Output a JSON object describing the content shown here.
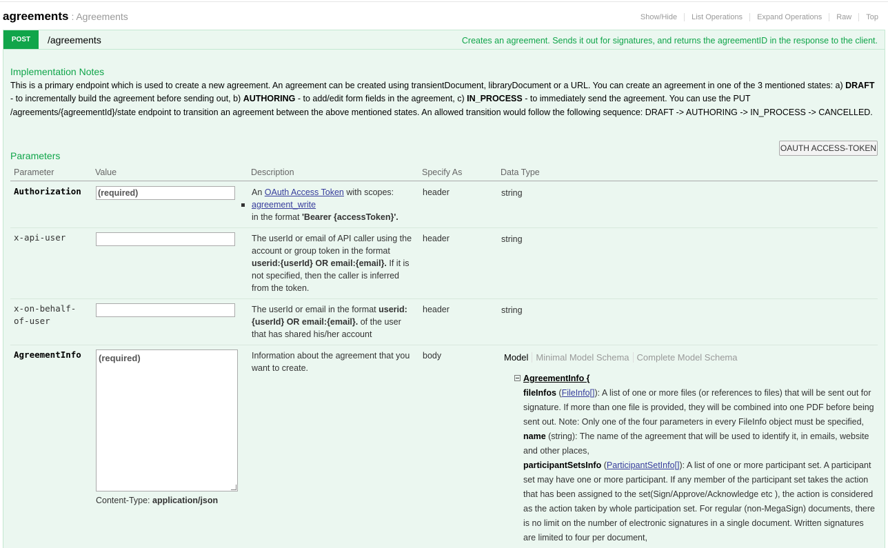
{
  "resource": {
    "name": "agreements",
    "separator": ":",
    "description": "Agreements"
  },
  "operations_menu": [
    "Show/Hide",
    "List Operations",
    "Expand Operations",
    "Raw",
    "Top"
  ],
  "operation": {
    "method": "POST",
    "path": "/agreements",
    "summary": "Creates an agreement. Sends it out for signatures, and returns the agreementID in the response to the client."
  },
  "implementation_notes": {
    "title": "Implementation Notes",
    "part1": "This is a primary endpoint which is used to create a new agreement. An agreement can be created using transientDocument, libraryDocument or a URL. You can create an agreement in one of the 3 mentioned states: a) ",
    "draft": "DRAFT",
    "part2": " - to incrementally build the agreement before sending out, b) ",
    "authoring": "AUTHORING",
    "part3": " - to add/edit form fields in the agreement, c) ",
    "in_process": "IN_PROCESS",
    "part4": " - to immediately send the agreement. You can use the PUT /agreements/{agreementId}/state endpoint to transition an agreement between the above mentioned states. An allowed transition would follow the following sequence: DRAFT -> AUTHORING -> IN_PROCESS -> CANCELLED."
  },
  "parameters": {
    "title": "Parameters",
    "token_button": "OAUTH ACCESS-TOKEN",
    "headers": {
      "parameter": "Parameter",
      "value": "Value",
      "description": "Description",
      "specify_as": "Specify As",
      "data_type": "Data Type"
    },
    "authorization": {
      "name": "Authorization",
      "placeholder": "(required)",
      "desc_prefix": "An ",
      "desc_link": "OAuth Access Token",
      "desc_mid": " with scopes:",
      "scope": "agreement_write",
      "desc_in_format": "in the format ",
      "desc_format": "'Bearer {accessToken}'.",
      "specify_as": "header",
      "data_type": "string"
    },
    "x_api_user": {
      "name": "x-api-user",
      "desc_pre": "The userId or email of API caller using the account or group token in the format ",
      "desc_format": "userid:{userId} OR email:{email}.",
      "desc_post": " If it is not specified, then the caller is inferred from the token.",
      "specify_as": "header",
      "data_type": "string"
    },
    "x_on_behalf": {
      "name_line1": "x-on-behalf-",
      "name_line2": "of-user",
      "desc_pre": "The userId or email in the format ",
      "desc_format": "userid:{userId} OR email:{email}.",
      "desc_post": " of the user that has shared his/her account",
      "specify_as": "header",
      "data_type": "string"
    },
    "agreement_info": {
      "name": "AgreementInfo",
      "placeholder": "(required)",
      "content_type_label": "Content-Type: ",
      "content_type": "application/json",
      "description": "Information about the agreement that you want to create.",
      "specify_as": "body"
    }
  },
  "model_tabs": [
    "Model",
    "Minimal Model Schema",
    "Complete Model Schema"
  ],
  "model": {
    "name": "AgreementInfo {",
    "fileinfos_name": "fileInfos",
    "fileinfos_type": "FileInfo[]",
    "fileinfos_desc": ": A list of one or more files (or references to files) that will be sent out for signature. If more than one file is provided, they will be combined into one PDF before being sent out. Note: Only one of the four parameters in every FileInfo object must be specified,",
    "name_name": "name",
    "name_desc": " (string): The name of the agreement that will be used to identify it, in emails, website and other places,",
    "psi_name": "participantSetsInfo",
    "psi_type": "ParticipantSetInfo[]",
    "psi_desc": ": A list of one or more participant set. A participant set may have one or more participant. If any member of the participant set takes the action that has been assigned to the set(Sign/Approve/Acknowledge etc ), the action is considered as the action taken by whole participation set. For regular (non-MegaSign) documents, there is no limit on the number of electronic signatures in a single document. Written signatures are limited to four per document,"
  }
}
